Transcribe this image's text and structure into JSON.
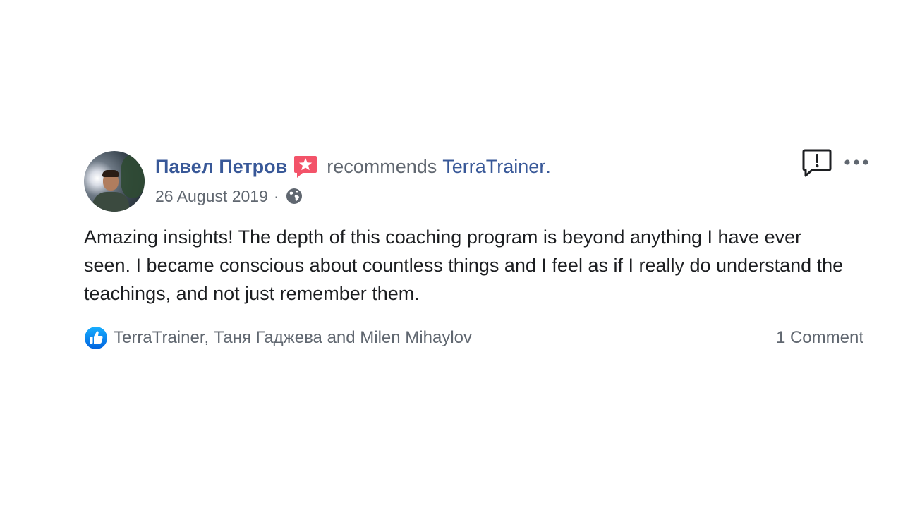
{
  "post": {
    "author": "Павел Петров",
    "action": "recommends",
    "page": "TerraTrainer",
    "period": ".",
    "date": "26 August 2019",
    "separator": "·",
    "privacy_icon": "globe-icon",
    "badge_icon": "recommendation-star-icon",
    "body": "Amazing insights! The depth of this coaching program is beyond anything I have ever seen. I became conscious about countless things and I feel as if I really do understand the teachings, and not just remember them.",
    "reactions": {
      "icon": "like-icon",
      "text": "TerraTrainer, Таня Гаджева and Milen Mihaylov"
    },
    "comments": "1 Comment",
    "actions": {
      "report_icon": "report-icon",
      "more_icon": "more-options-icon"
    }
  },
  "colors": {
    "link": "#385898",
    "secondary_text": "#606770",
    "body_text": "#1c1e21",
    "badge": "#f35369",
    "like": "#1877f2"
  }
}
